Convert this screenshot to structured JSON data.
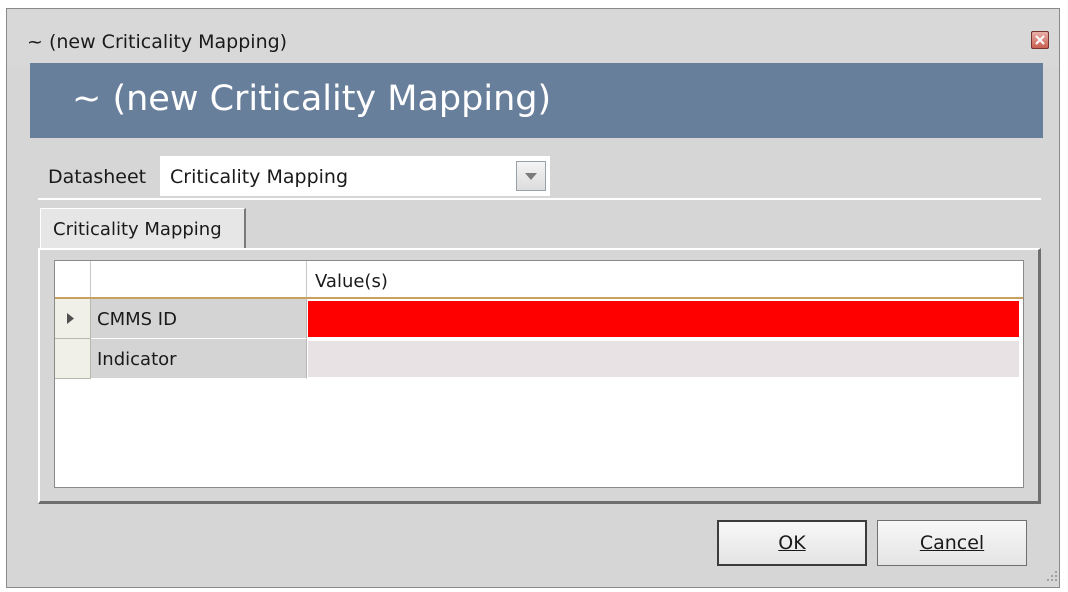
{
  "window": {
    "title": "~ (new Criticality Mapping)",
    "header": "~ (new Criticality Mapping)"
  },
  "datasheet": {
    "label": "Datasheet",
    "selected": "Criticality Mapping"
  },
  "tabs": [
    {
      "label": "Criticality Mapping",
      "active": true
    }
  ],
  "grid": {
    "columns": [
      "",
      "Value(s)"
    ],
    "rows": [
      {
        "name": "CMMS ID",
        "value": "",
        "current": true,
        "required": true,
        "color": "#ff0000"
      },
      {
        "name": "Indicator",
        "value": "",
        "current": false,
        "required": false,
        "color": "#e8e2e4"
      }
    ]
  },
  "buttons": {
    "ok": "OK",
    "cancel": "Cancel"
  },
  "icons": {
    "close": "close-icon",
    "dropdown": "chevron-down-icon",
    "row_pointer": "row-pointer-icon",
    "resize_grip": "resize-grip-icon"
  }
}
